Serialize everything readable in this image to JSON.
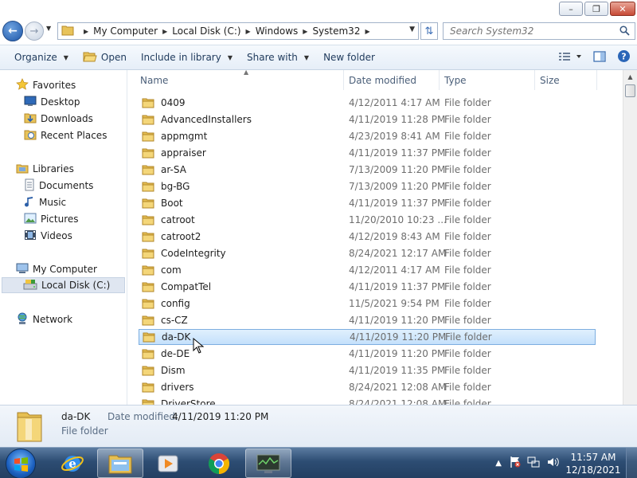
{
  "address": {
    "crumbs": [
      "My Computer",
      "Local Disk (C:)",
      "Windows",
      "System32"
    ]
  },
  "search": {
    "placeholder": "Search System32"
  },
  "toolbar": {
    "organize": "Organize",
    "open": "Open",
    "include": "Include in library",
    "share": "Share with",
    "new_folder": "New folder"
  },
  "nav": {
    "favorites": "Favorites",
    "desktop": "Desktop",
    "downloads": "Downloads",
    "recent": "Recent Places",
    "libraries": "Libraries",
    "documents": "Documents",
    "music": "Music",
    "pictures": "Pictures",
    "videos": "Videos",
    "computer": "My Computer",
    "local_disk": "Local Disk (C:)",
    "network": "Network"
  },
  "columns": {
    "name": "Name",
    "date": "Date modified",
    "type": "Type",
    "size": "Size"
  },
  "rows": [
    {
      "name": "0409",
      "date": "4/12/2011 4:17 AM",
      "type": "File folder"
    },
    {
      "name": "AdvancedInstallers",
      "date": "4/11/2019 11:28 PM",
      "type": "File folder"
    },
    {
      "name": "appmgmt",
      "date": "4/23/2019 8:41 AM",
      "type": "File folder"
    },
    {
      "name": "appraiser",
      "date": "4/11/2019 11:37 PM",
      "type": "File folder"
    },
    {
      "name": "ar-SA",
      "date": "7/13/2009 11:20 PM",
      "type": "File folder"
    },
    {
      "name": "bg-BG",
      "date": "7/13/2009 11:20 PM",
      "type": "File folder"
    },
    {
      "name": "Boot",
      "date": "4/11/2019 11:37 PM",
      "type": "File folder"
    },
    {
      "name": "catroot",
      "date": "11/20/2010 10:23 ...",
      "type": "File folder"
    },
    {
      "name": "catroot2",
      "date": "4/12/2019 8:43 AM",
      "type": "File folder"
    },
    {
      "name": "CodeIntegrity",
      "date": "8/24/2021 12:17 AM",
      "type": "File folder"
    },
    {
      "name": "com",
      "date": "4/12/2011 4:17 AM",
      "type": "File folder"
    },
    {
      "name": "CompatTel",
      "date": "4/11/2019 11:37 PM",
      "type": "File folder"
    },
    {
      "name": "config",
      "date": "11/5/2021 9:54 PM",
      "type": "File folder"
    },
    {
      "name": "cs-CZ",
      "date": "4/11/2019 11:20 PM",
      "type": "File folder"
    },
    {
      "name": "da-DK",
      "date": "4/11/2019 11:20 PM",
      "type": "File folder"
    },
    {
      "name": "de-DE",
      "date": "4/11/2019 11:20 PM",
      "type": "File folder"
    },
    {
      "name": "Dism",
      "date": "4/11/2019 11:35 PM",
      "type": "File folder"
    },
    {
      "name": "drivers",
      "date": "8/24/2021 12:08 AM",
      "type": "File folder"
    },
    {
      "name": "DriverStore",
      "date": "8/24/2021 12:08 AM",
      "type": "File folder"
    }
  ],
  "details": {
    "name": "da-DK",
    "date_label": "Date modified:",
    "date_value": "4/11/2019 11:20 PM",
    "type": "File folder"
  },
  "clock": {
    "time": "11:57 AM",
    "date": "12/18/2021"
  }
}
